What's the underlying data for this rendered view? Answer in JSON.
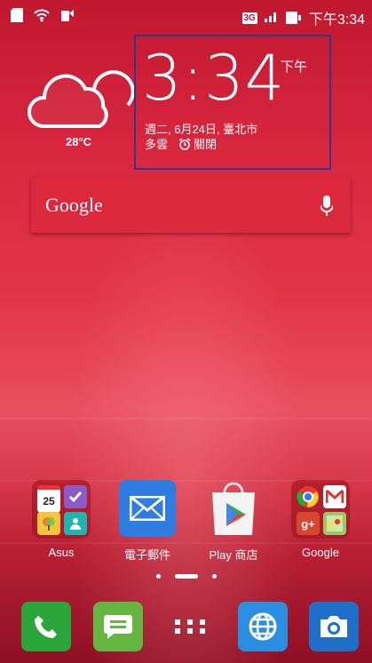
{
  "status_bar": {
    "network": "3G",
    "time": "下午3:34"
  },
  "weather": {
    "temperature": "28°C"
  },
  "clock": {
    "time": "3:34",
    "ampm": "下午",
    "date": "週二, 6月24日, 臺北市",
    "condition": "多雲",
    "alarm": "關閉"
  },
  "search": {
    "label": "Google"
  },
  "apps": {
    "folder_asus": {
      "label": "Asus",
      "calendar_day": "25"
    },
    "email": {
      "label": "電子郵件"
    },
    "play_store": {
      "label": "Play 商店"
    },
    "folder_google": {
      "label": "Google"
    }
  },
  "colors": {
    "wallpaper": "#d9263f",
    "clock_frame": "#2b3a8f"
  }
}
